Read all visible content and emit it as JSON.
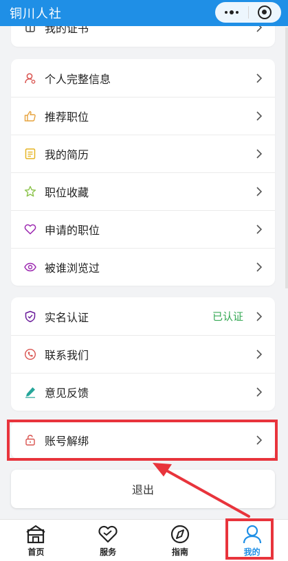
{
  "header": {
    "title": "铜川人社"
  },
  "top_card": {
    "label": "我的证书"
  },
  "profile_menu": [
    {
      "label": "个人完整信息",
      "icon": "user-icon"
    },
    {
      "label": "推荐职位",
      "icon": "thumbs-up-icon"
    },
    {
      "label": "我的简历",
      "icon": "resume-icon"
    },
    {
      "label": "职位收藏",
      "icon": "star-icon"
    },
    {
      "label": "申请的职位",
      "icon": "heart-icon"
    },
    {
      "label": "被谁浏览过",
      "icon": "eye-icon"
    }
  ],
  "account_menu": [
    {
      "label": "实名认证",
      "status": "已认证",
      "icon": "shield-check-icon"
    },
    {
      "label": "联系我们",
      "icon": "phone-icon"
    },
    {
      "label": "意见反馈",
      "icon": "pencil-icon"
    }
  ],
  "unbind": {
    "label": "账号解绑",
    "icon": "lock-icon"
  },
  "logout": {
    "label": "退出"
  },
  "tabbar": [
    {
      "label": "首页",
      "icon": "home-icon"
    },
    {
      "label": "服务",
      "icon": "service-heart-icon"
    },
    {
      "label": "指南",
      "icon": "compass-icon"
    },
    {
      "label": "我的",
      "icon": "profile-icon",
      "active": true
    }
  ],
  "colors": {
    "brand": "#1f8fe6",
    "status_ok": "#34a853",
    "annotation": "#e8343c"
  }
}
